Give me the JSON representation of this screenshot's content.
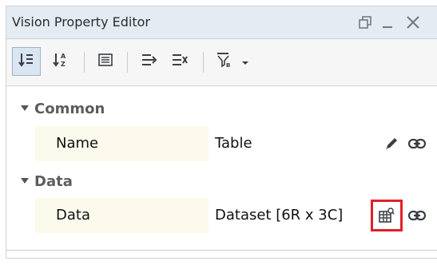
{
  "window": {
    "title": "Vision Property Editor"
  },
  "toolbar": {
    "buttons": [
      {
        "name": "sort-by-category",
        "icon": "sort-category-icon",
        "active": true
      },
      {
        "name": "sort-alphabetical",
        "icon": "sort-az-icon",
        "active": false
      },
      {
        "name": "show-description",
        "icon": "description-panel-icon",
        "active": false
      },
      {
        "name": "expand-all",
        "icon": "expand-all-icon",
        "active": false
      },
      {
        "name": "collapse-all",
        "icon": "collapse-all-icon",
        "active": false
      },
      {
        "name": "filter-properties",
        "icon": "filter-icon",
        "active": false
      }
    ]
  },
  "categories": [
    {
      "label": "Common",
      "properties": [
        {
          "name": "Name",
          "value": "Table",
          "actions": [
            "pencil-icon",
            "link-icon"
          ]
        }
      ]
    },
    {
      "label": "Data",
      "properties": [
        {
          "name": "Data",
          "value": "Dataset [6R x 3C]",
          "actions": [
            "dataset-viewer-icon",
            "link-icon"
          ],
          "highlighted_action": "dataset-viewer-icon"
        }
      ]
    }
  ],
  "colors": {
    "titlebar": "#e4ebf3",
    "name_cell": "#fbfaed",
    "highlight": "#e0202a",
    "active_button": "#d9e5f1"
  }
}
